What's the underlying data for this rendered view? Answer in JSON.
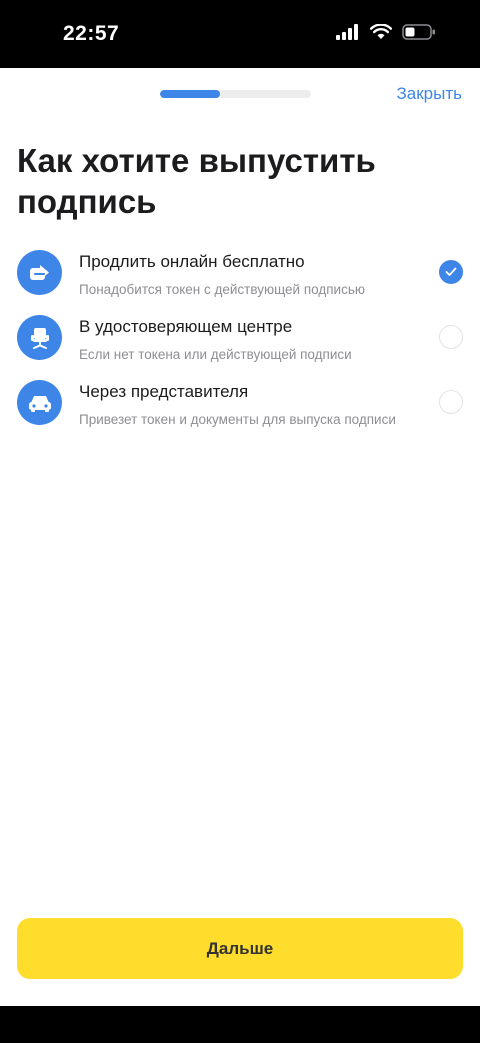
{
  "status_bar": {
    "time": "22:57"
  },
  "header": {
    "progress_fraction": 0.4,
    "close_label": "Закрыть"
  },
  "title": "Как хотите выпустить подпись",
  "options": [
    {
      "title": "Продлить онлайн бесплатно",
      "subtitle": "Понадобится токен с действующей подписью",
      "icon": "arrow-share-icon",
      "selected": true
    },
    {
      "title": "В удостоверяющем центре",
      "subtitle": "Если нет токена или действующей подписи",
      "icon": "office-chair-icon",
      "selected": false
    },
    {
      "title": "Через представителя",
      "subtitle": "Привезет токен и документы для выпуска подписи",
      "icon": "car-icon",
      "selected": false
    }
  ],
  "footer": {
    "next_label": "Дальше"
  },
  "colors": {
    "accent": "#3d86e8",
    "primary_button": "#ffdd2d"
  }
}
